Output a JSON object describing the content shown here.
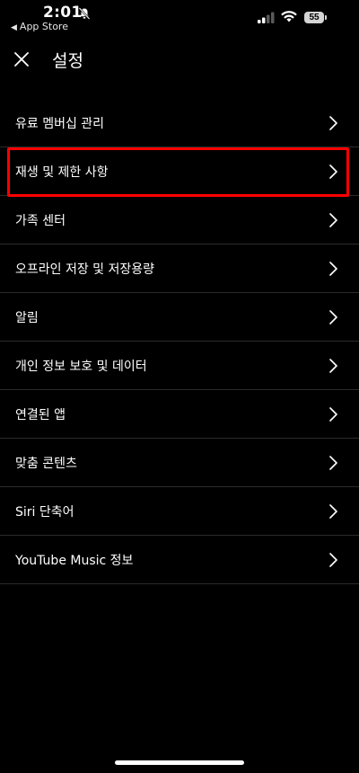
{
  "status_bar": {
    "time": "2:01",
    "back_app": "App Store",
    "battery": "55",
    "icons": [
      "bell-slash-icon",
      "signal-icon",
      "wifi-icon",
      "battery-icon"
    ]
  },
  "header": {
    "close_icon": "close-icon",
    "title": "설정"
  },
  "menu": {
    "items": [
      {
        "label": "유료 멤버십 관리"
      },
      {
        "label": "재생 및 제한 사항",
        "highlighted": true
      },
      {
        "label": "가족 센터"
      },
      {
        "label": "오프라인 저장 및 저장용량"
      },
      {
        "label": "알림"
      },
      {
        "label": "개인 정보 보호 및 데이터"
      },
      {
        "label": "연결된 앱"
      },
      {
        "label": "맞춤 콘텐츠"
      },
      {
        "label": "Siri 단축어"
      },
      {
        "label": "YouTube Music 정보"
      }
    ],
    "chevron_icon": "chevron-right-icon"
  },
  "colors": {
    "background": "#000000",
    "text": "#ffffff",
    "divider": "#2b2b2b",
    "highlight": "#ff0000"
  }
}
